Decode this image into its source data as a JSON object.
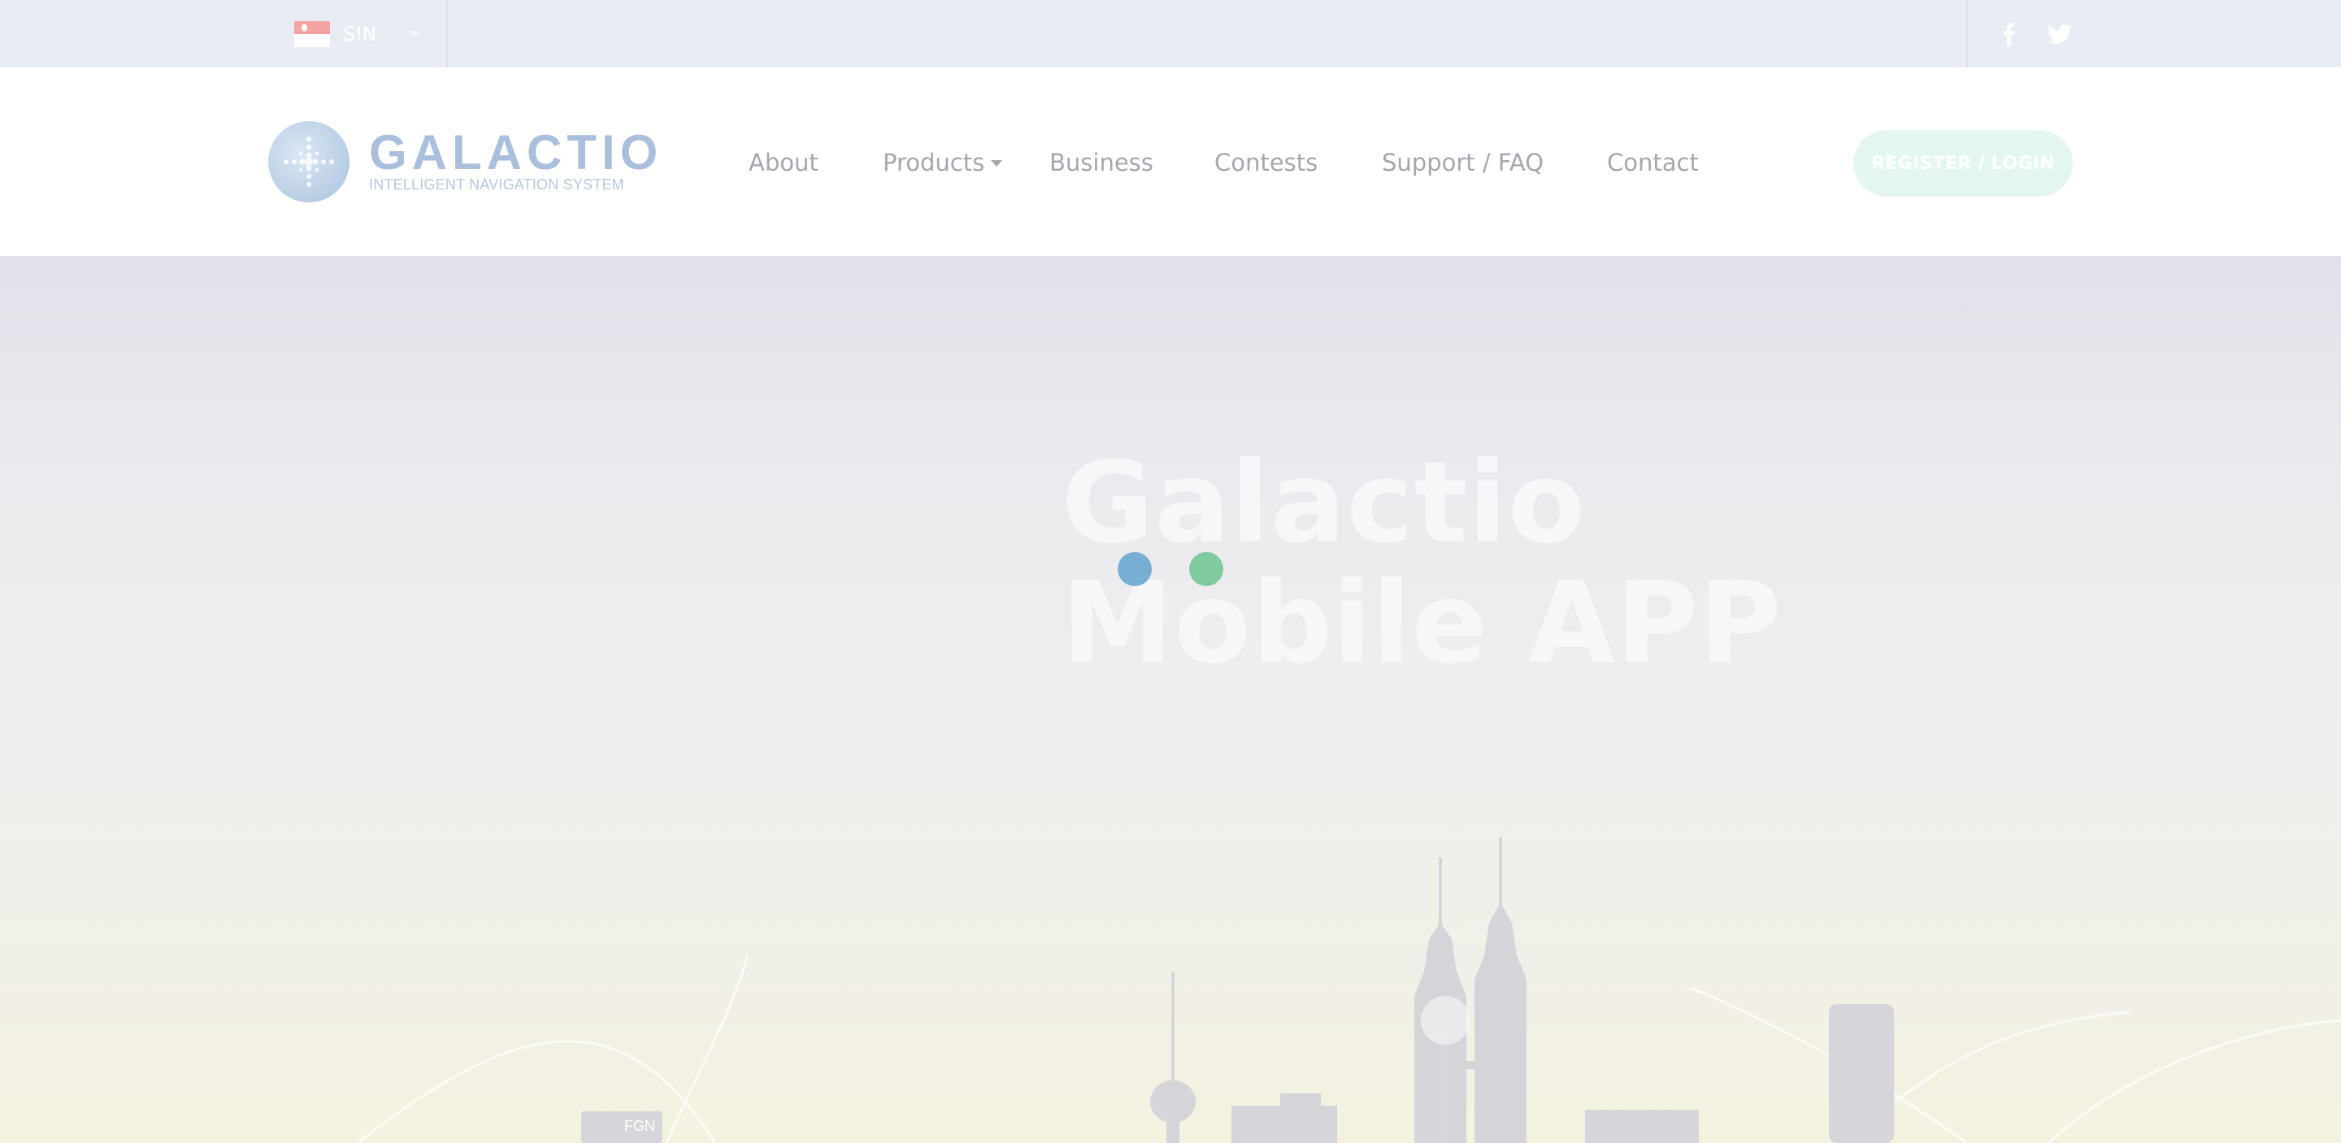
{
  "topbar": {
    "language": {
      "code": "SIN",
      "flag": "singapore-flag"
    },
    "social": [
      {
        "name": "facebook",
        "icon": "facebook-icon"
      },
      {
        "name": "twitter",
        "icon": "twitter-icon"
      }
    ]
  },
  "header": {
    "logo": {
      "word": "GALACTIO",
      "tagline": "INTELLIGENT NAVIGATION SYSTEM"
    },
    "nav": {
      "about": "About",
      "products": "Products",
      "business": "Business",
      "contests": "Contests",
      "support": "Support / FAQ",
      "contact": "Contact"
    },
    "cta_label": "REGISTER / LOGIN"
  },
  "hero": {
    "title_line1": "Galactio",
    "title_line2": "Mobile APP",
    "skyline_sign": "FGN"
  },
  "loader": {
    "dot_colors": [
      "#78aed3",
      "#7fcb9f"
    ]
  },
  "colors": {
    "topbar_bg": "#e8ecf4",
    "nav_text": "#a6a6b0",
    "logo": "#a9bfdc",
    "cta_bg": "#e4f7ef"
  }
}
